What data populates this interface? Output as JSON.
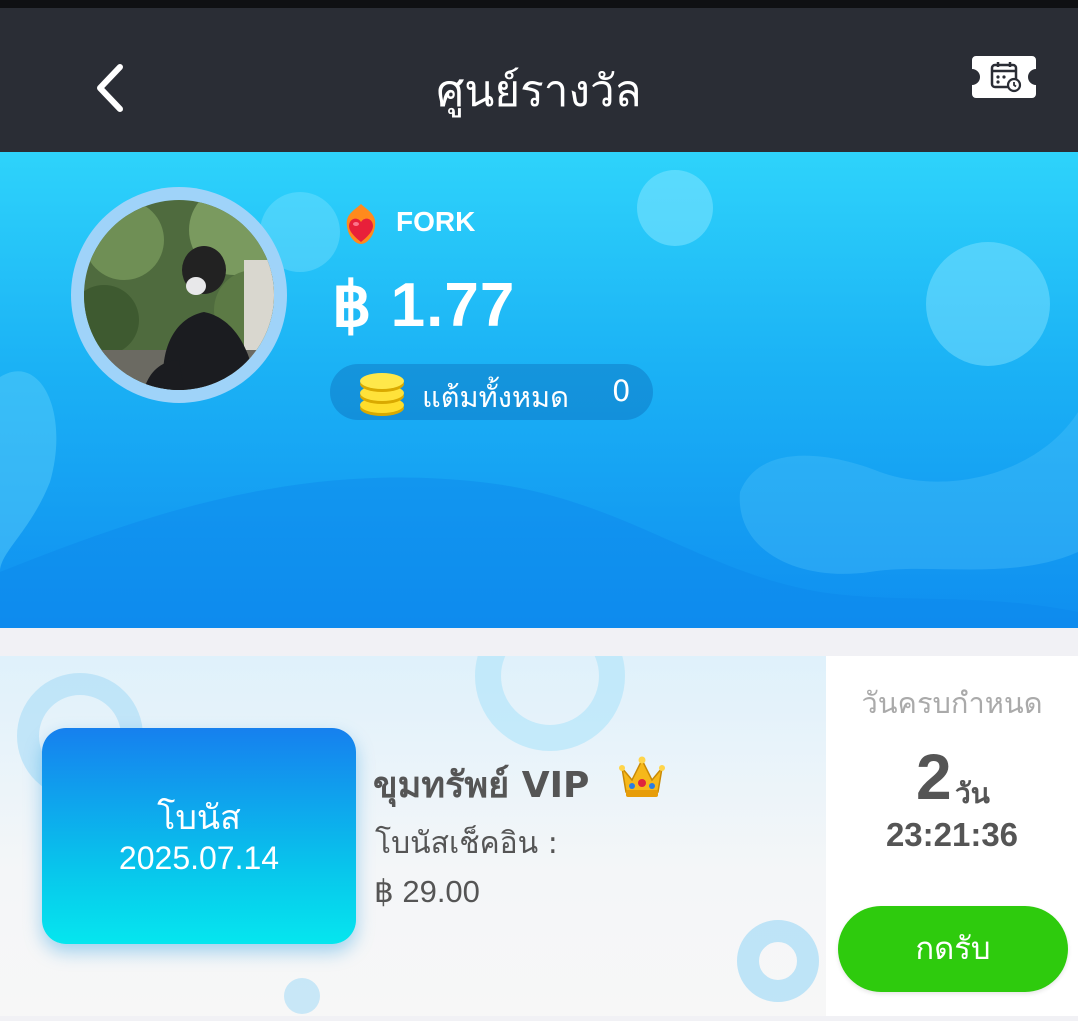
{
  "header": {
    "title": "ศูนย์รางวัล",
    "back_icon": "chevron-left-icon",
    "ticket_icon": "calendar-ticket-icon"
  },
  "profile": {
    "username": "FORK",
    "balance": "฿ 1.77",
    "level_icon": "heart-flame-icon",
    "points": {
      "label": "แต้มทั้งหมด",
      "value": "0",
      "icon": "coins-stack-icon"
    }
  },
  "reward_card": {
    "bonus_label": "โบนัส",
    "bonus_date": "2025.07.14",
    "title": "ขุมทรัพย์ VIP",
    "title_icon": "crown-icon",
    "checkin_label": "โบนัสเช็คอิน :",
    "checkin_amount": "฿ 29.00",
    "deadline_label": "วันครบกำหนด",
    "days_remaining": "2",
    "days_unit": "วัน",
    "countdown": "23:21:36",
    "claim_label": "กดรับ"
  },
  "colors": {
    "header_bg": "#2a2d35",
    "hero_top": "#2ed3fb",
    "hero_bottom": "#0f8ef0",
    "claim_green": "#2ecb0d",
    "bonus_gradient_top": "#1680ee",
    "bonus_gradient_bottom": "#05e6ee"
  }
}
